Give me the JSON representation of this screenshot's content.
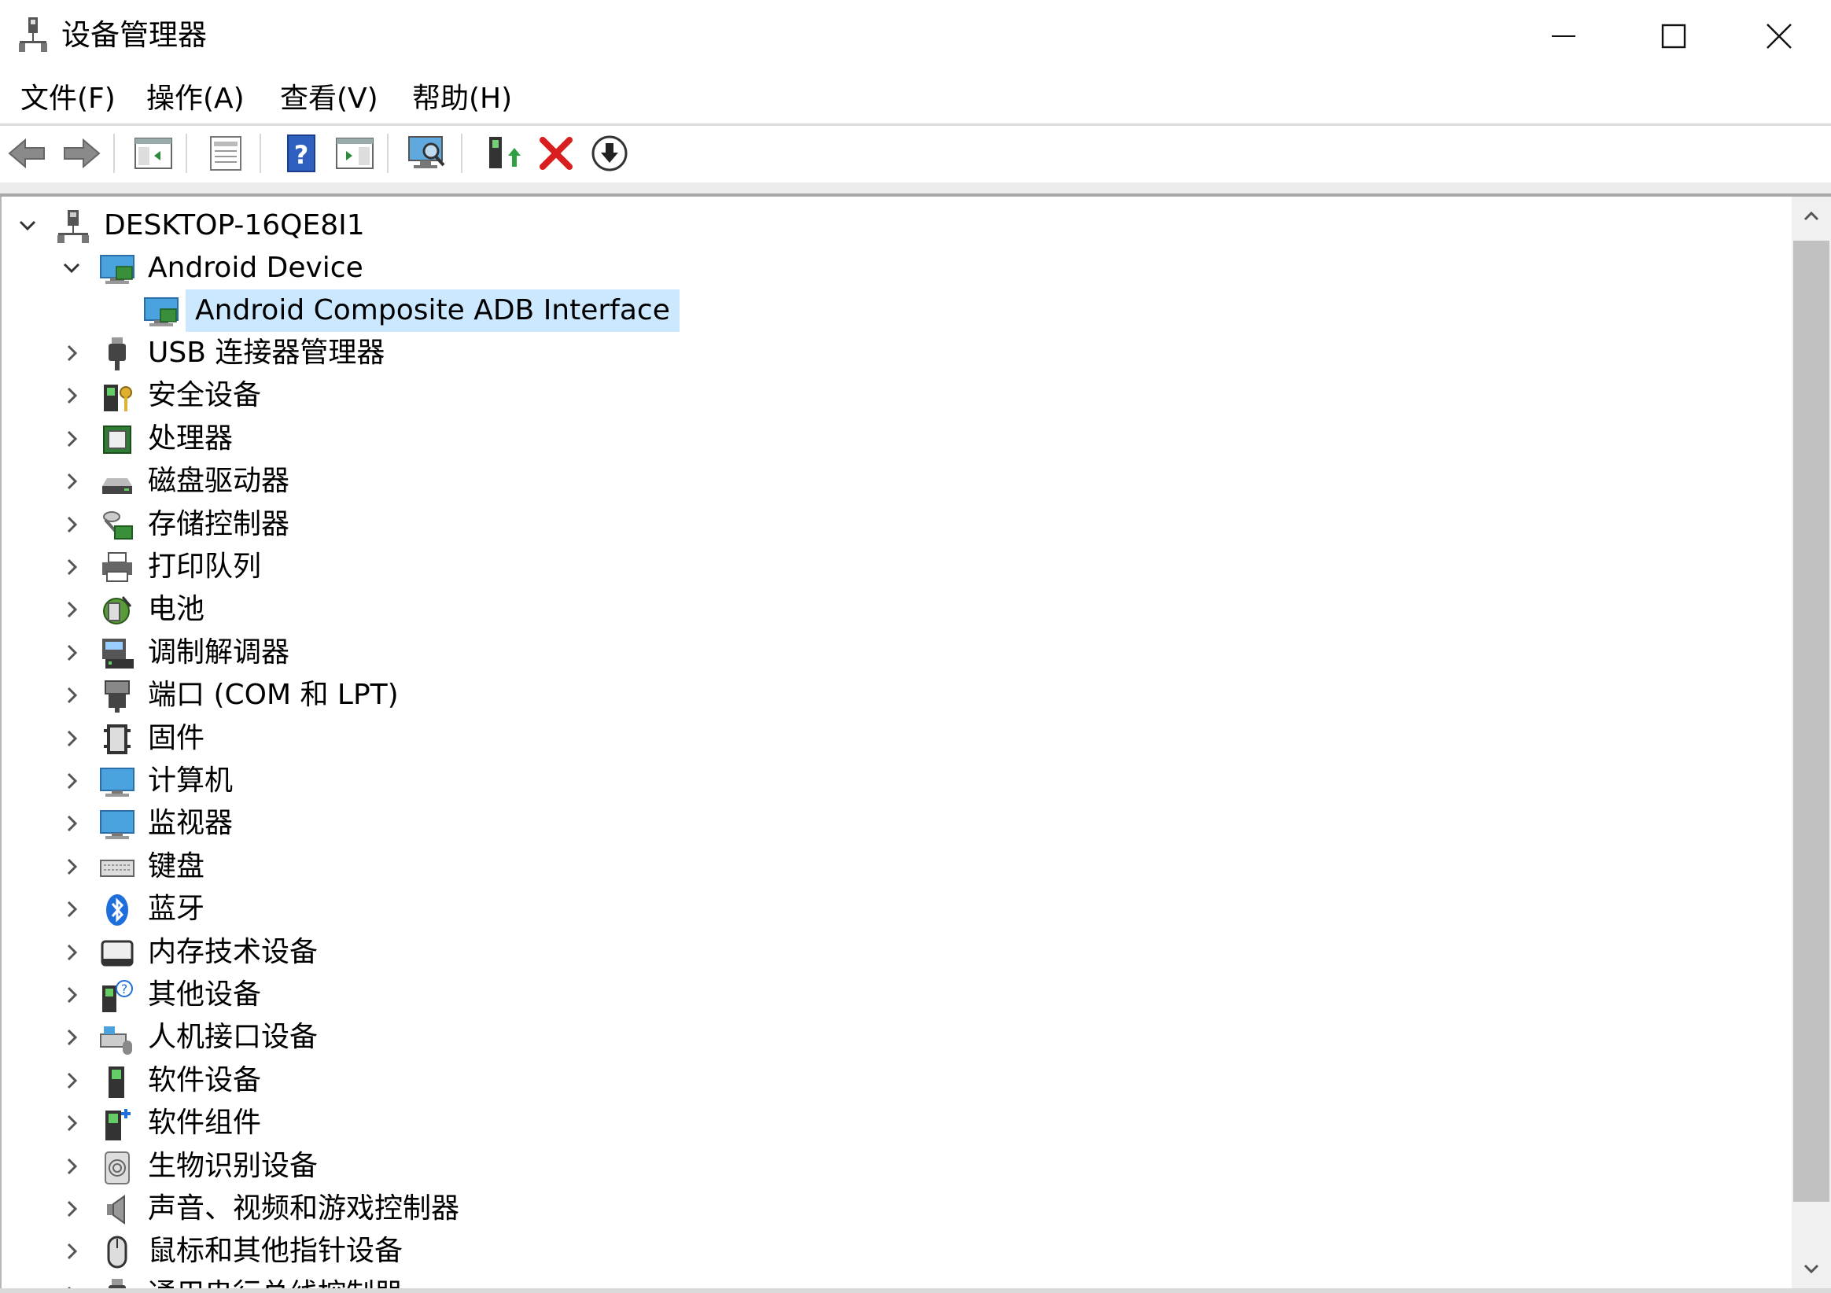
{
  "window": {
    "title": "设备管理器"
  },
  "menu": [
    "文件(F)",
    "操作(A)",
    "查看(V)",
    "帮助(H)"
  ],
  "toolbar": [
    {
      "icon": "back-arrow-icon"
    },
    {
      "icon": "forward-arrow-icon"
    },
    {
      "icon": "show-hide-console-tree-icon"
    },
    {
      "icon": "properties-icon"
    },
    {
      "icon": "help-icon"
    },
    {
      "icon": "show-action-pane-icon"
    },
    {
      "icon": "scan-hardware-changes-icon"
    },
    {
      "icon": "update-driver-icon"
    },
    {
      "icon": "uninstall-device-icon"
    },
    {
      "icon": "disable-device-icon"
    }
  ],
  "tree": {
    "root": "DESKTOP-16QE8I1",
    "expanded_group": "Android Device",
    "selected_child": "Android Composite ADB Interface",
    "categories": [
      "USB 连接器管理器",
      "安全设备",
      "处理器",
      "磁盘驱动器",
      "存储控制器",
      "打印队列",
      "电池",
      "调制解调器",
      "端口 (COM 和 LPT)",
      "固件",
      "计算机",
      "监视器",
      "键盘",
      "蓝牙",
      "内存技术设备",
      "其他设备",
      "人机接口设备",
      "软件设备",
      "软件组件",
      "生物识别设备",
      "声音、视频和游戏控制器",
      "鼠标和其他指针设备",
      "通用串行总线控制器"
    ]
  }
}
